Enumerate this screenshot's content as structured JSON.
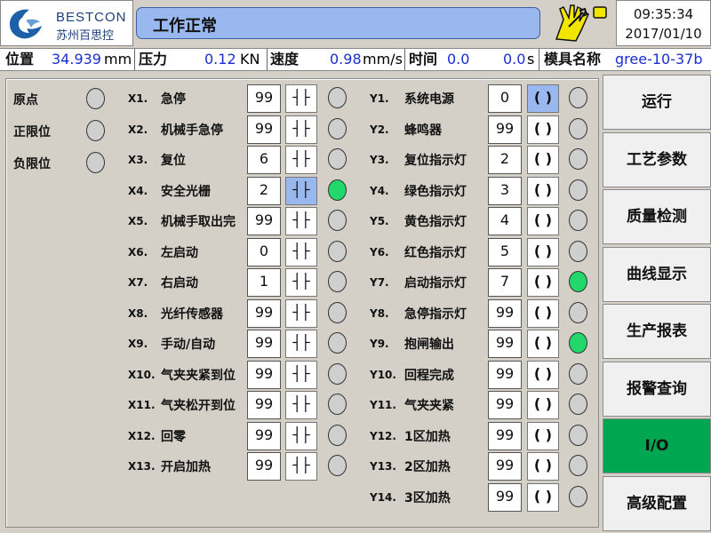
{
  "header": {
    "logo_brand": "BESTCON",
    "logo_sub": "苏州百思控",
    "status": "工作正常",
    "time": "09:35:34",
    "date": "2017/01/10"
  },
  "infobar": {
    "position_label": "位置",
    "position_value": "34.939",
    "position_unit": "mm",
    "pressure_label": "压力",
    "pressure_value": "0.12",
    "pressure_unit": "KN",
    "speed_label": "速度",
    "speed_value": "0.98",
    "speed_unit": "mm/s",
    "time_label": "时间",
    "time_value1": "0.0",
    "time_value2": "0.0",
    "time_unit": "s",
    "mold_label": "模具名称",
    "mold_value": "gree-10-37b"
  },
  "left_status": [
    {
      "label": "原点",
      "on": false
    },
    {
      "label": "正限位",
      "on": false
    },
    {
      "label": "负限位",
      "on": false
    }
  ],
  "inputs": [
    {
      "code": "X1.",
      "label": "急停",
      "value": "99",
      "symbol": "┤├",
      "active": false,
      "on": false
    },
    {
      "code": "X2.",
      "label": "机械手急停",
      "value": "99",
      "symbol": "┤├",
      "active": false,
      "on": false
    },
    {
      "code": "X3.",
      "label": "复位",
      "value": "6",
      "symbol": "┤├",
      "active": false,
      "on": false
    },
    {
      "code": "X4.",
      "label": "安全光栅",
      "value": "2",
      "symbol": "┤├",
      "active": true,
      "on": true
    },
    {
      "code": "X5.",
      "label": "机械手取出完",
      "value": "99",
      "symbol": "┤├",
      "active": false,
      "on": false
    },
    {
      "code": "X6.",
      "label": "左启动",
      "value": "0",
      "symbol": "┤├",
      "active": false,
      "on": false
    },
    {
      "code": "X7.",
      "label": "右启动",
      "value": "1",
      "symbol": "┤├",
      "active": false,
      "on": false
    },
    {
      "code": "X8.",
      "label": "光纤传感器",
      "value": "99",
      "symbol": "┤├",
      "active": false,
      "on": false
    },
    {
      "code": "X9.",
      "label": "手动/自动",
      "value": "99",
      "symbol": "┤├",
      "active": false,
      "on": false
    },
    {
      "code": "X10.",
      "label": "气夹夹紧到位",
      "value": "99",
      "symbol": "┤├",
      "active": false,
      "on": false
    },
    {
      "code": "X11.",
      "label": "气夹松开到位",
      "value": "99",
      "symbol": "┤├",
      "active": false,
      "on": false
    },
    {
      "code": "X12.",
      "label": "回零",
      "value": "99",
      "symbol": "┤├",
      "active": false,
      "on": false
    },
    {
      "code": "X13.",
      "label": "开启加热",
      "value": "99",
      "symbol": "┤├",
      "active": false,
      "on": false
    }
  ],
  "outputs": [
    {
      "code": "Y1.",
      "label": "系统电源",
      "value": "0",
      "symbol": "( )",
      "active": true,
      "on": false
    },
    {
      "code": "Y2.",
      "label": "蜂鸣器",
      "value": "99",
      "symbol": "( )",
      "active": false,
      "on": false
    },
    {
      "code": "Y3.",
      "label": "复位指示灯",
      "value": "2",
      "symbol": "( )",
      "active": false,
      "on": false
    },
    {
      "code": "Y4.",
      "label": "绿色指示灯",
      "value": "3",
      "symbol": "( )",
      "active": false,
      "on": false
    },
    {
      "code": "Y5.",
      "label": "黄色指示灯",
      "value": "4",
      "symbol": "( )",
      "active": false,
      "on": false
    },
    {
      "code": "Y6.",
      "label": "红色指示灯",
      "value": "5",
      "symbol": "( )",
      "active": false,
      "on": false
    },
    {
      "code": "Y7.",
      "label": "启动指示灯",
      "value": "7",
      "symbol": "( )",
      "active": false,
      "on": true
    },
    {
      "code": "Y8.",
      "label": "急停指示灯",
      "value": "99",
      "symbol": "( )",
      "active": false,
      "on": false
    },
    {
      "code": "Y9.",
      "label": "抱闸输出",
      "value": "99",
      "symbol": "( )",
      "active": false,
      "on": true
    },
    {
      "code": "Y10.",
      "label": "回程完成",
      "value": "99",
      "symbol": "( )",
      "active": false,
      "on": false
    },
    {
      "code": "Y11.",
      "label": "气夹夹紧",
      "value": "99",
      "symbol": "( )",
      "active": false,
      "on": false
    },
    {
      "code": "Y12.",
      "label": "1区加热",
      "value": "99",
      "symbol": "( )",
      "active": false,
      "on": false
    },
    {
      "code": "Y13.",
      "label": "2区加热",
      "value": "99",
      "symbol": "( )",
      "active": false,
      "on": false
    },
    {
      "code": "Y14.",
      "label": "3区加热",
      "value": "99",
      "symbol": "( )",
      "active": false,
      "on": false
    }
  ],
  "nav": [
    {
      "label": "运行",
      "selected": false
    },
    {
      "label": "工艺参数",
      "selected": false
    },
    {
      "label": "质量检测",
      "selected": false
    },
    {
      "label": "曲线显示",
      "selected": false
    },
    {
      "label": "生产报表",
      "selected": false
    },
    {
      "label": "报警查询",
      "selected": false
    },
    {
      "label": "I/O",
      "selected": true
    },
    {
      "label": "高级配置",
      "selected": false
    }
  ],
  "colors": {
    "accent_blue": "#9ab8f0",
    "lamp_on": "#22d86a",
    "nav_selected": "#00a651",
    "value_blue": "#1a2fd0"
  }
}
